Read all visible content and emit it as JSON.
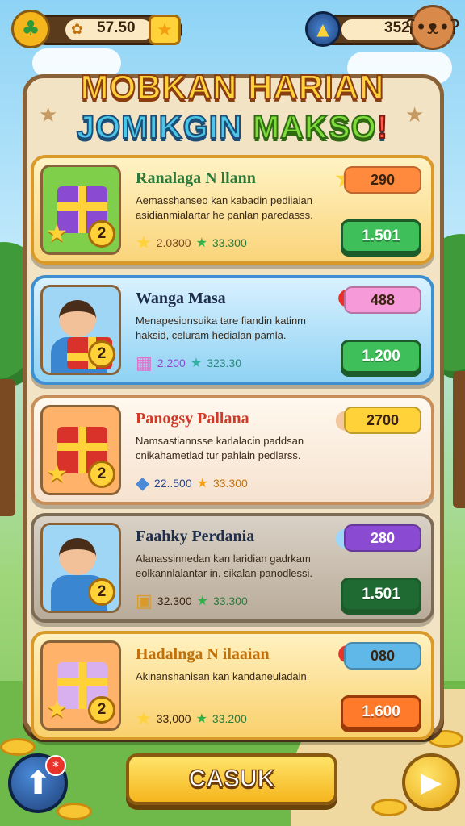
{
  "top_bar": {
    "currency_left": {
      "value": "57.50",
      "icon": "clover-icon",
      "badge_icon": "star-icon"
    },
    "currency_right": {
      "value": "352",
      "icon": "bell-icon",
      "mascot": "bear-icon"
    }
  },
  "panel": {
    "title_line1": "MOBKAN HARIAN",
    "title_line2_a": "JOMIKGIN ",
    "title_line2_b": "MAKSO",
    "title_line2_c": "!"
  },
  "quests": [
    {
      "title": "Ranalaga N llann",
      "title_color": "#2a7a3a",
      "description": "Aemasshanseo kan kabadin pediiaian asidianmialartar he panlan paredasss.",
      "thumb": "gift-box-purple",
      "level": "2",
      "stat_icon": "star-icon",
      "stat1": "2.0300",
      "stat2": "33.300",
      "reward": "290",
      "reward_icon": "star-icon",
      "reward_color": "#ff8a3d",
      "claim_label": "1.501",
      "claim_color": "#3fbf5a"
    },
    {
      "title": "Wanga Masa",
      "title_color": "#1f2e4a",
      "description": "Menapesionsuika tare fiandin katinm haksid, celuram hedialan pamla.",
      "thumb": "person-with-box",
      "level": "2",
      "stat_icon": "cube-icon",
      "stat1": "2.200",
      "stat2": "323.30",
      "reward": "488",
      "reward_icon": "bear-icon",
      "reward_color": "#f79ad9",
      "claim_label": "1.200",
      "claim_color": "#3fbf5a"
    },
    {
      "title": "Panogsy Pallana",
      "title_color": "#d13a2a",
      "description": "Namsastiannsse karlalacin paddsan cnikahametlad tur pahlain pedlarss.",
      "thumb": "gift-box-red",
      "level": "2",
      "stat_icon": "gem-icon",
      "stat1": "22..500",
      "stat2": "33.300",
      "reward": "2700",
      "reward_icon": "chick-icon",
      "reward_color": "#ffd23a",
      "claim_label": "",
      "claim_color": ""
    },
    {
      "title": "Faahky Perdania",
      "title_color": "#1f2e4a",
      "description": "Alanassinnedan kan laridian gadrkam eolkannlalantar in. sikalan panodlessi.",
      "thumb": "person-with-tablet",
      "level": "2",
      "stat_icon": "crate-icon",
      "stat1": "32.300",
      "stat2": "33.300",
      "reward": "280",
      "reward_icon": "ghost-icon",
      "reward_color": "#8a4ad1",
      "claim_label": "1.501",
      "claim_color": "#1f6a33"
    },
    {
      "title": "Hadalnga N ilaaian",
      "title_color": "#c2700a",
      "description": "Akinanshanisan kan kandaneuladain",
      "thumb": "gift-box-lilac",
      "level": "2",
      "stat_icon": "star-icon",
      "stat1": "33,000",
      "stat2": "33.200",
      "reward": "080",
      "reward_icon": "bear-icon",
      "reward_color": "#5fb8e8",
      "claim_label": "1.600",
      "claim_color": "#ff7a2a"
    }
  ],
  "bottom": {
    "main_button": "CASUK",
    "left_button_icon": "arrow-up-icon",
    "left_badge": "*",
    "right_button_icon": "play-icon"
  }
}
